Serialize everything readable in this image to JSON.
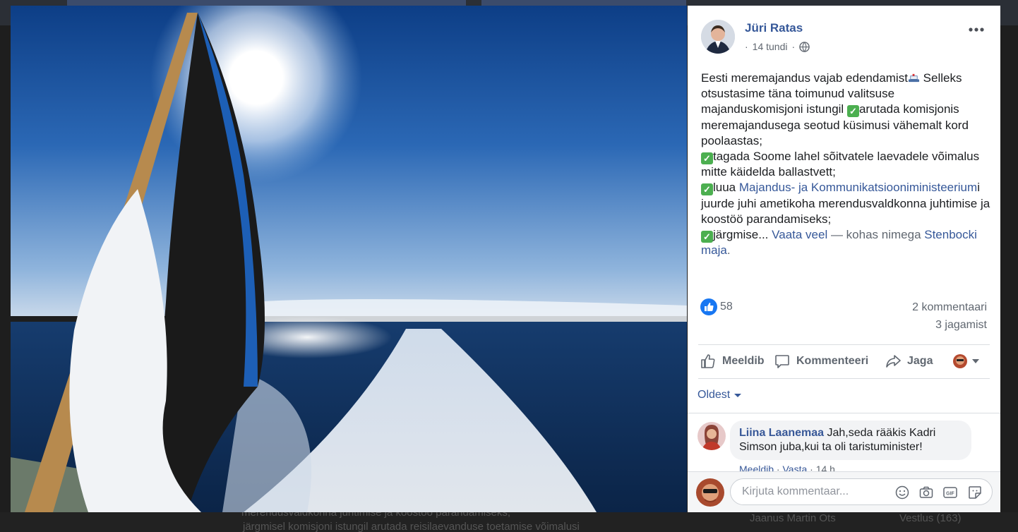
{
  "post": {
    "author": "Jüri Ratas",
    "time": "14 tundi",
    "dot": "·",
    "text": {
      "p1": "Eesti meremajandus vajab edendamist",
      "p2": " Selleks otsustasime täna toimunud valitsuse majanduskomisjoni istungil ",
      "p3": "arutada komisjonis meremajandusega seotud küsimusi vähemalt kord poolaastas;",
      "p4": "tagada Soome lahel sõitvatele laevadele võimalus mitte käidelda ballastvett;",
      "p5": "luua ",
      "p5_link": "Majandus- ja Kommunikatsiooniministeerium",
      "p5_rest": "i juurde juhi ametikoha merendusvaldkonna juhtimise ja koostöö parandamiseks;",
      "p6": "järgmise...",
      "see_more": "Vaata veel",
      "place_prefix": " — kohas nimega ",
      "place": "Stenbocki maja",
      "place_end": "."
    }
  },
  "stats": {
    "likes": "58",
    "comments": "2 kommentaari",
    "shares": "3 jagamist"
  },
  "actions": {
    "like": "Meeldib",
    "comment": "Kommenteeri",
    "share": "Jaga"
  },
  "sort": {
    "label": "Oldest"
  },
  "comment": {
    "name": "Liina Laanemaa",
    "text": "Jah,seda rääkis Kadri Simson juba,kui ta oli taristuminister!",
    "like": "Meeldib",
    "reply": "Vasta",
    "time": "14 h",
    "sep": " · "
  },
  "composer": {
    "placeholder": "Kirjuta kommentaar..."
  },
  "background": {
    "bottom_text_1": "merendusvaldkonna juhtimise ja koostöö parandamiseks;",
    "bottom_text_2": "järgmisel komisjoni istungil arutada reisilaevanduse toetamise võimalusi",
    "bottom_text_3": "Jaanus Martin Ots",
    "bottom_text_4": "Vestlus (163)"
  },
  "colors": {
    "link": "#365899",
    "muted": "#606770",
    "like_blue": "#1877f2",
    "check_green": "#4caf50"
  }
}
